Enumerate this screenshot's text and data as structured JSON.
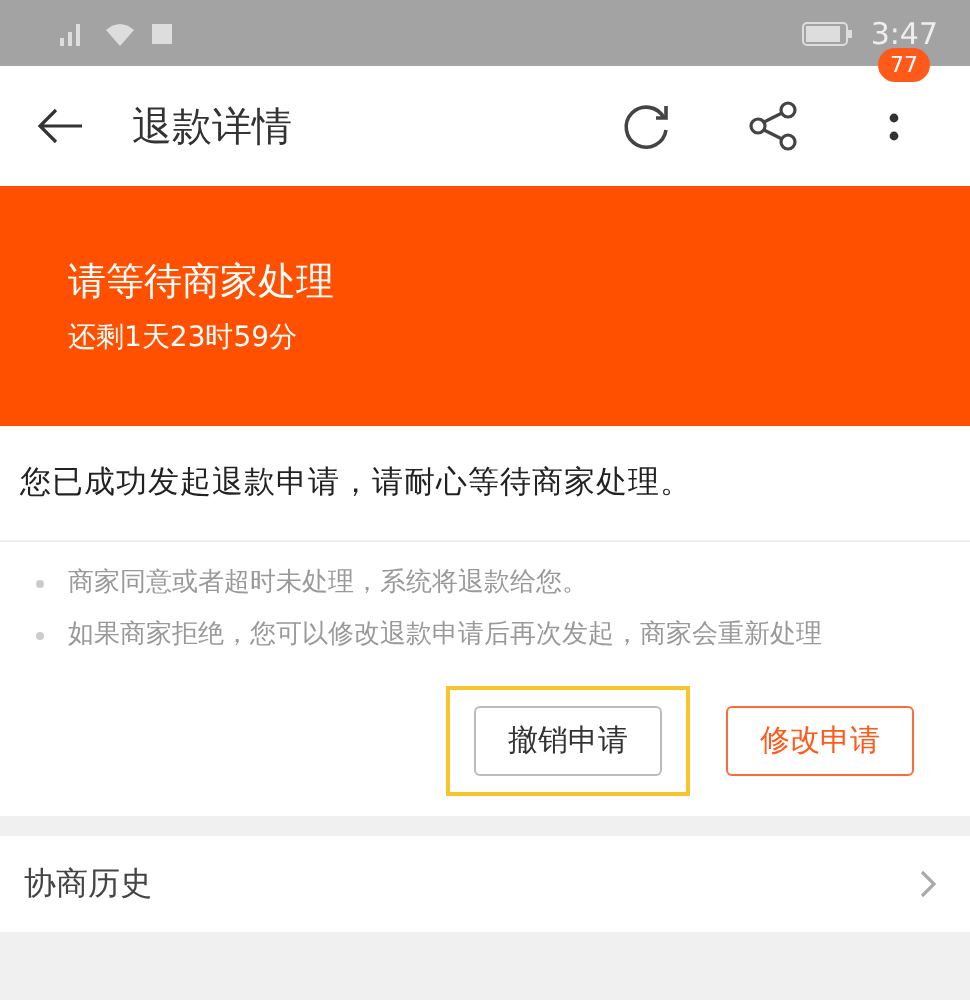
{
  "status_bar": {
    "time": "3:47"
  },
  "toolbar": {
    "title": "退款详情",
    "badge": "77"
  },
  "banner": {
    "title": "请等待商家处理",
    "countdown": "还剩1天23时59分"
  },
  "message": "您已成功发起退款申请，请耐心等待商家处理。",
  "notes": [
    "商家同意或者超时未处理，系统将退款给您。",
    "如果商家拒绝，您可以修改退款申请后再次发起，商家会重新处理"
  ],
  "buttons": [
    {
      "label": "撤销申请",
      "kind": "plain",
      "highlighted": true
    },
    {
      "label": "修改申请",
      "kind": "primary",
      "highlighted": false
    }
  ],
  "history": {
    "label": "协商历史"
  }
}
